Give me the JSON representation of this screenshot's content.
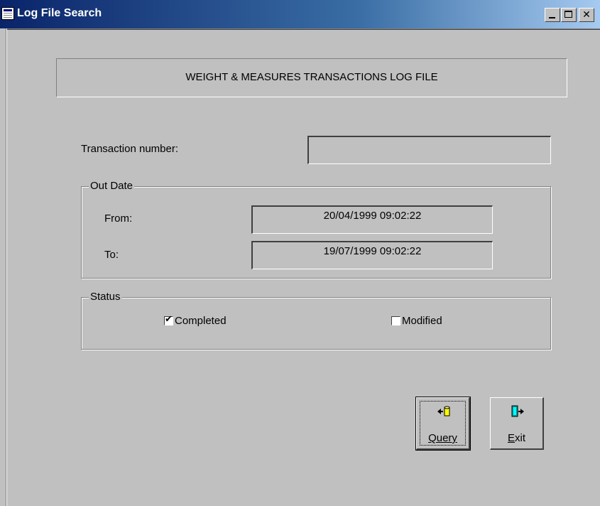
{
  "window": {
    "title": "Log File Search",
    "controls": {
      "minimize": "minimize",
      "maximize": "maximize",
      "close": "✕"
    }
  },
  "banner": {
    "text": "WEIGHT & MEASURES TRANSACTIONS LOG FILE"
  },
  "transaction": {
    "label": "Transaction number:",
    "value": ""
  },
  "out_date": {
    "legend": "Out Date",
    "from_label": "From:",
    "from_value": "20/04/1999 09:02:22",
    "to_label": "To:",
    "to_value": "19/07/1999 09:02:22"
  },
  "status": {
    "legend": "Status",
    "completed_label": "Completed",
    "completed_checked": true,
    "modified_label": "Modified",
    "modified_checked": false
  },
  "buttons": {
    "query_label": "Query",
    "query_icon": "query-database-icon",
    "exit_label": "Exit",
    "exit_icon": "exit-door-icon"
  },
  "colors": {
    "face": "#c0c0c0",
    "title_start": "#0a246a",
    "title_end": "#a6caf0"
  }
}
